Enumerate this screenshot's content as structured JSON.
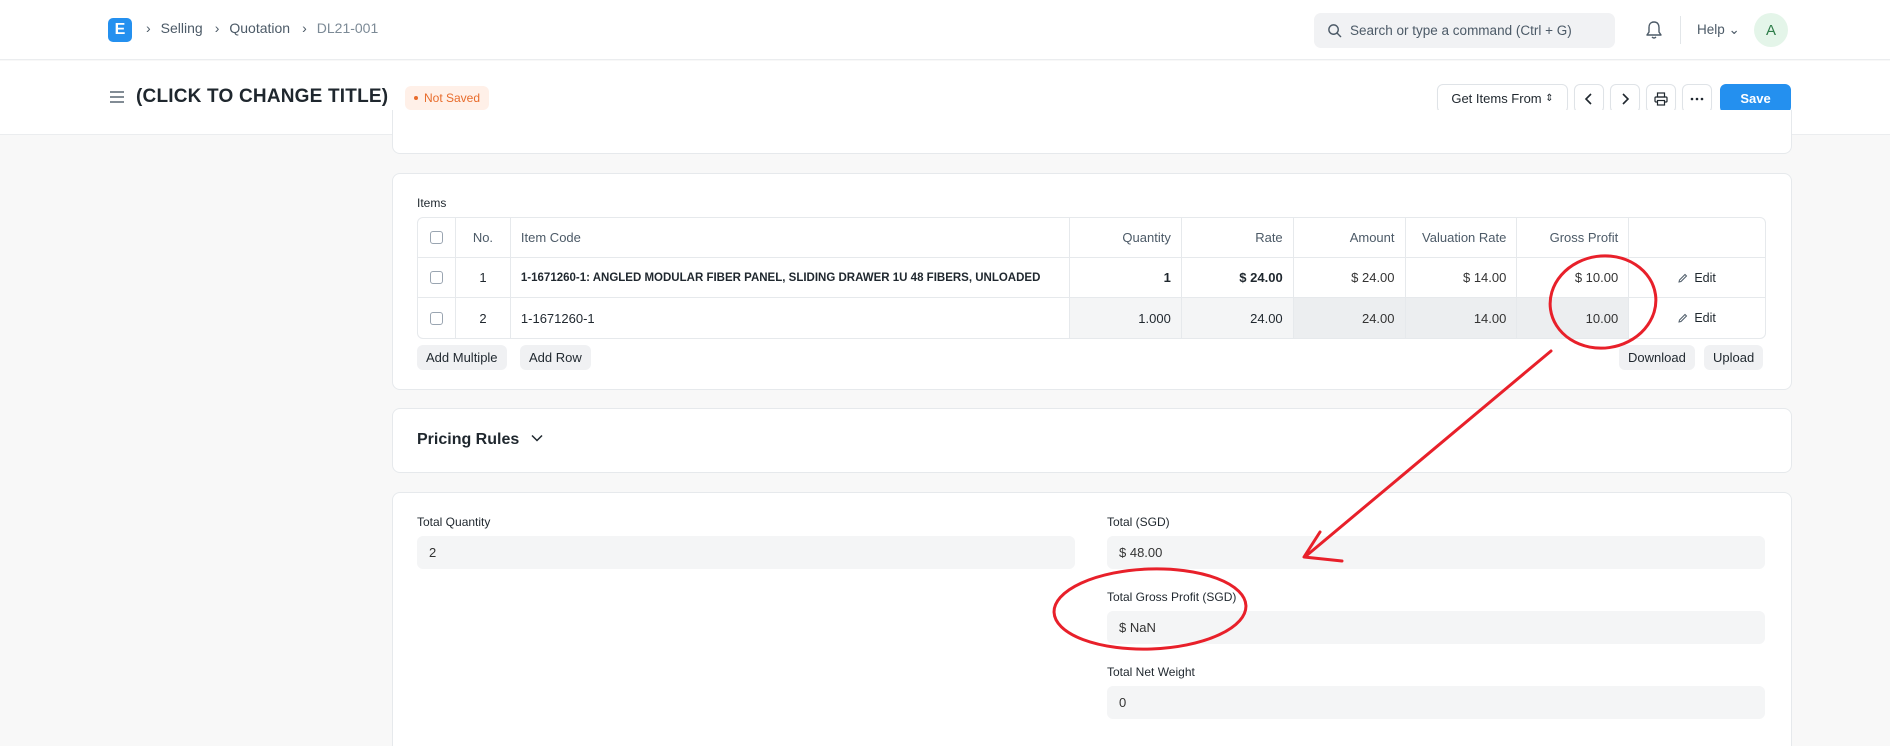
{
  "navbar": {
    "logo_letter": "E",
    "breadcrumbs": [
      "Selling",
      "Quotation",
      "DL21-001"
    ],
    "search_placeholder": "Search or type a command (Ctrl + G)",
    "help_label": "Help",
    "avatar_initial": "A"
  },
  "page_head": {
    "title": "(CLICK TO CHANGE TITLE)",
    "status": "Not Saved",
    "get_items_label": "Get Items From",
    "save_label": "Save"
  },
  "items": {
    "section_label": "Items",
    "columns": [
      "No.",
      "Item Code",
      "Quantity",
      "Rate",
      "Amount",
      "Valuation Rate",
      "Gross Profit"
    ],
    "rows": [
      {
        "no": "1",
        "item_code": "1-1671260-1: ANGLED MODULAR FIBER PANEL, SLIDING DRAWER 1U 48 FIBERS, UNLOADED",
        "quantity": "1",
        "rate": "$ 24.00",
        "amount": "$ 24.00",
        "valuation_rate": "$ 14.00",
        "gross_profit": "$ 10.00",
        "edit": "Edit"
      },
      {
        "no": "2",
        "item_code": "1-1671260-1",
        "quantity": "1.000",
        "rate": "24.00",
        "amount": "24.00",
        "valuation_rate": "14.00",
        "gross_profit": "10.00",
        "edit": "Edit"
      }
    ],
    "add_multiple_label": "Add Multiple",
    "add_row_label": "Add Row",
    "download_label": "Download",
    "upload_label": "Upload"
  },
  "pricing_rules": {
    "title": "Pricing Rules"
  },
  "totals": {
    "total_quantity_label": "Total Quantity",
    "total_quantity_value": "2",
    "total_label": "Total (SGD)",
    "total_value": "$ 48.00",
    "total_gross_profit_label": "Total Gross Profit (SGD)",
    "total_gross_profit_value": "$ NaN",
    "total_net_weight_label": "Total Net Weight",
    "total_net_weight_value": "0"
  },
  "colors": {
    "primary": "#2490ef",
    "annotation": "#e8202a",
    "status": "#e86c2c"
  }
}
